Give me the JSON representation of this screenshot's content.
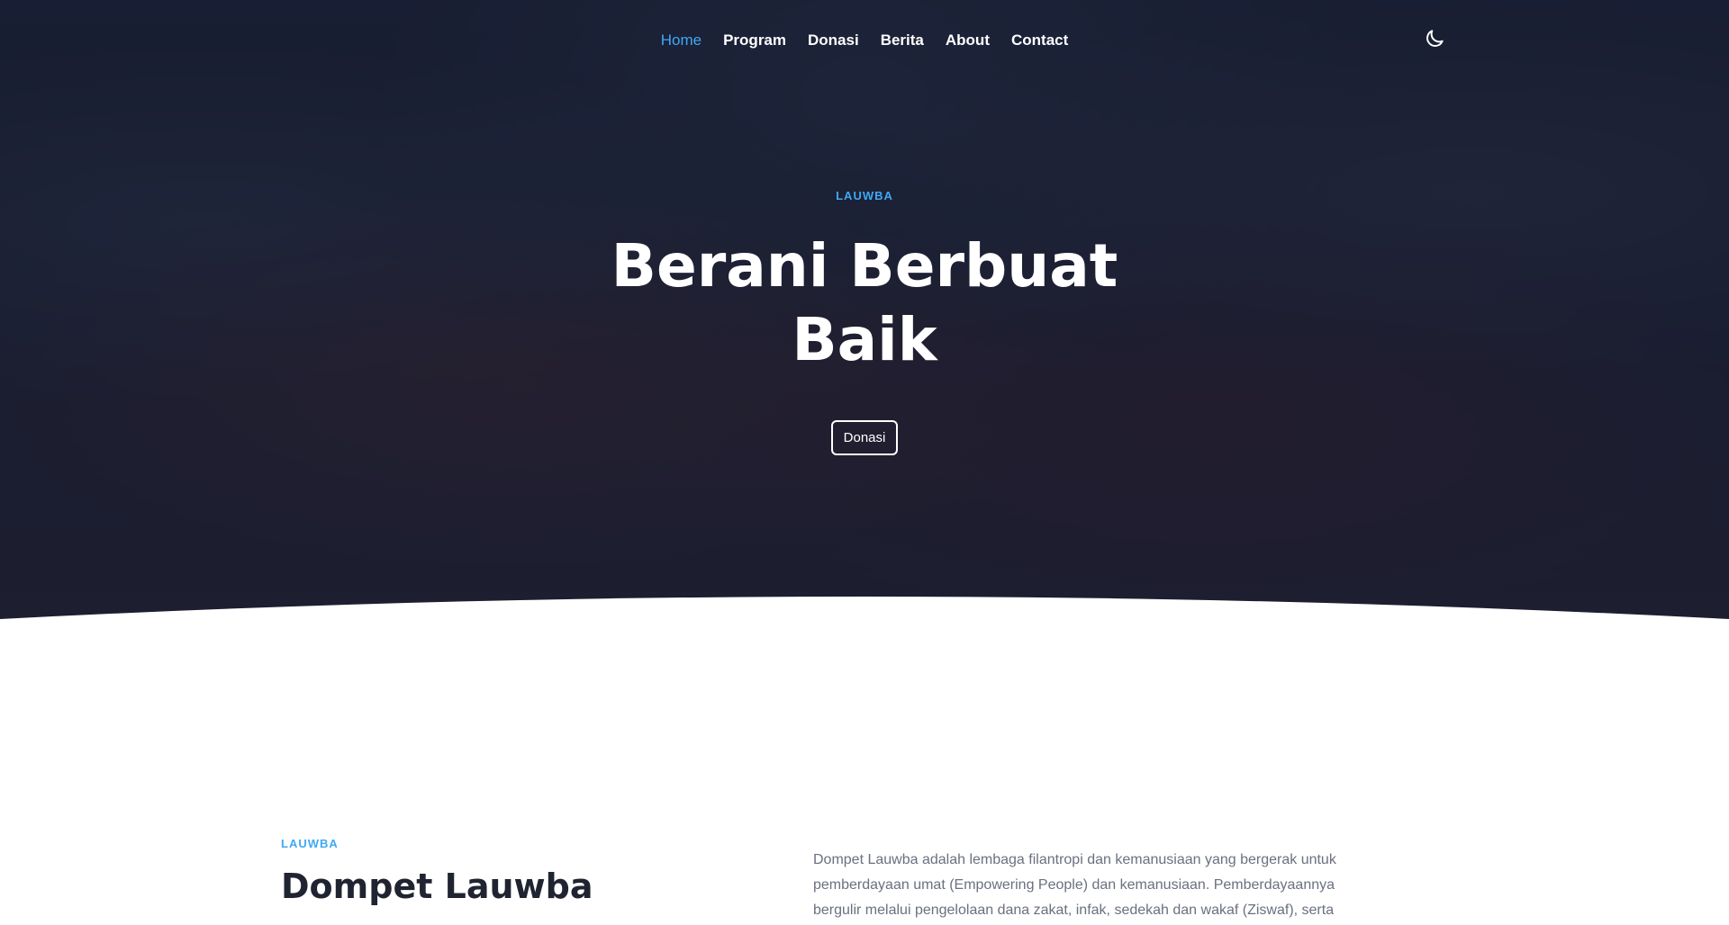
{
  "nav": {
    "items": [
      {
        "label": "Home",
        "active": true
      },
      {
        "label": "Program",
        "active": false
      },
      {
        "label": "Donasi",
        "active": false
      },
      {
        "label": "Berita",
        "active": false
      },
      {
        "label": "About",
        "active": false
      },
      {
        "label": "Contact",
        "active": false
      }
    ],
    "theme_toggle_icon": "moon-icon"
  },
  "hero": {
    "eyebrow": "LAUWBA",
    "title": "Berani Berbuat Baik",
    "button_label": "Donasi"
  },
  "about": {
    "eyebrow": "LAUWBA",
    "title": "Dompet Lauwba",
    "text": "Dompet Lauwba adalah lembaga filantropi dan kemanusiaan yang bergerak untuk pemberdayaan umat (Empowering People) dan kemanusiaan. Pemberdayaannya bergulir melalui pengelolaan dana zakat, infak, sedekah dan wakaf (Ziswaf), serta"
  },
  "colors": {
    "accent": "#3fa9f5",
    "overlay": "#12182e",
    "text_dark": "#1f2430",
    "text_muted": "#6b7080"
  }
}
